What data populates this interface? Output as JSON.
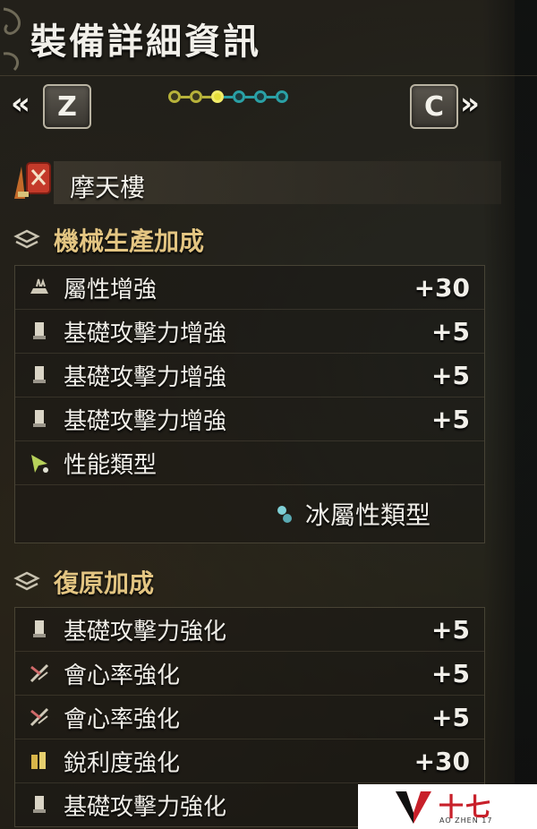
{
  "header": {
    "title": "裝備詳細資訊",
    "left_key": "Z",
    "right_key": "C",
    "left_arrow": "«",
    "right_arrow": "»"
  },
  "pager": {
    "total": 6,
    "active_index": 2
  },
  "weapon": {
    "name": "摩天樓"
  },
  "sections": [
    {
      "title": "機械生產加成",
      "rows": [
        {
          "icon": "element-boost-icon",
          "name": "屬性增強",
          "value": "+30"
        },
        {
          "icon": "attack-boost-icon",
          "name": "基礎攻擊力增強",
          "value": "+5"
        },
        {
          "icon": "attack-boost-icon",
          "name": "基礎攻擊力增強",
          "value": "+5"
        },
        {
          "icon": "attack-boost-icon",
          "name": "基礎攻擊力增強",
          "value": "+5"
        },
        {
          "icon": "performance-type-icon",
          "name": "性能類型",
          "value": ""
        }
      ],
      "sub_row": {
        "icon": "ice-element-icon",
        "name": "冰屬性類型"
      }
    },
    {
      "title": "復原加成",
      "rows": [
        {
          "icon": "attack-boost-icon",
          "name": "基礎攻擊力強化",
          "value": "+5"
        },
        {
          "icon": "affinity-boost-icon",
          "name": "會心率強化",
          "value": "+5"
        },
        {
          "icon": "affinity-boost-icon",
          "name": "會心率強化",
          "value": "+5"
        },
        {
          "icon": "sharpness-boost-icon",
          "name": "銳利度強化",
          "value": "+30"
        },
        {
          "icon": "attack-boost-icon",
          "name": "基礎攻擊力強化",
          "value": ""
        }
      ]
    }
  ],
  "watermark": {
    "cn": "十七",
    "en": "AO ZHEN 17"
  }
}
